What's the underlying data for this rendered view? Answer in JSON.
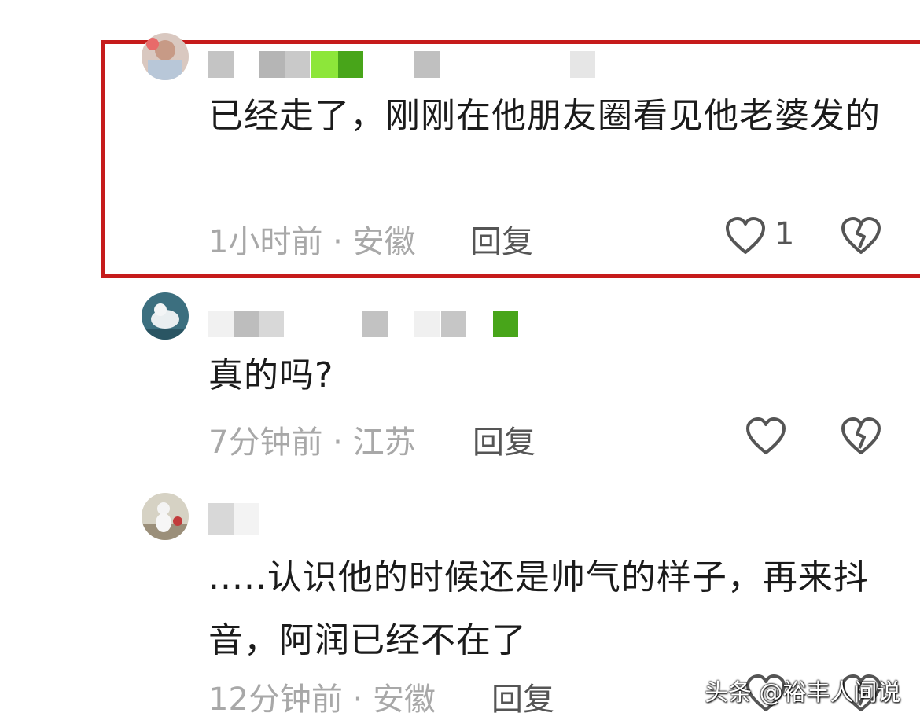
{
  "comments": [
    {
      "text": "已经走了，刚刚在他朋友圈看见他老婆发的",
      "meta": "1小时前 · 安徽",
      "reply_label": "回复",
      "like_count": "1"
    },
    {
      "text": "真的吗?",
      "meta": "7分钟前 · 江苏",
      "reply_label": "回复",
      "like_count": ""
    },
    {
      "text": ".....认识他的时候还是帅气的样子，再来抖音，阿润已经不在了",
      "meta": "12分钟前 · 安徽",
      "reply_label": "回复",
      "like_count": ""
    }
  ],
  "watermark": "头条 @裕丰人间说",
  "colors": {
    "highlight": "#c61b1b",
    "meta": "#a8a8a8",
    "text": "#1b1b1b"
  },
  "icons": {
    "like": "heart-outline-icon",
    "dislike": "broken-heart-icon"
  }
}
